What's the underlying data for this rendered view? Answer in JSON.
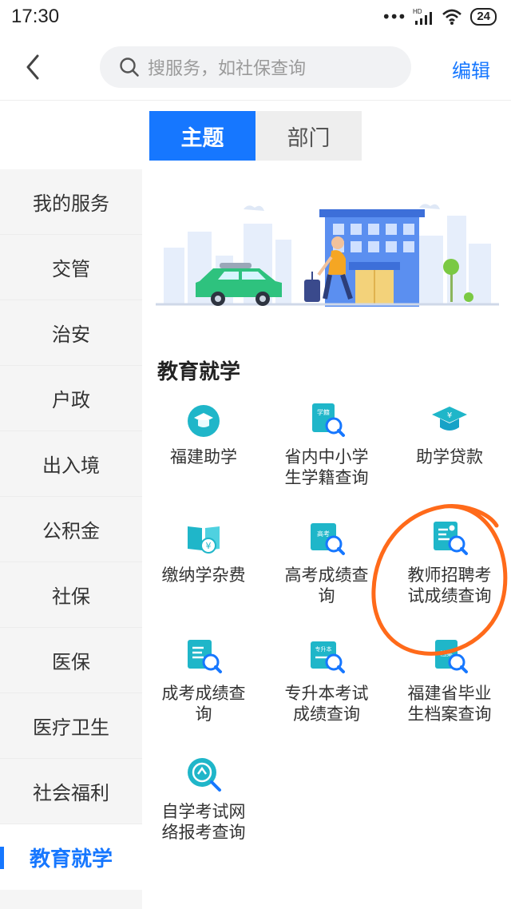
{
  "status": {
    "time": "17:30",
    "network": "HD",
    "battery": "24"
  },
  "nav": {
    "search_placeholder": "搜服务，如社保查询",
    "edit": "编辑"
  },
  "tabs": [
    {
      "label": "主题",
      "active": true
    },
    {
      "label": "部门",
      "active": false
    }
  ],
  "sidebar": {
    "items": [
      {
        "label": "我的服务"
      },
      {
        "label": "交管"
      },
      {
        "label": "治安"
      },
      {
        "label": "户政"
      },
      {
        "label": "出入境"
      },
      {
        "label": "公积金"
      },
      {
        "label": "社保"
      },
      {
        "label": "医保"
      },
      {
        "label": "医疗卫生"
      },
      {
        "label": "社会福利"
      },
      {
        "label": "教育就学",
        "active": true
      }
    ]
  },
  "section": {
    "title": "教育就学"
  },
  "services": [
    {
      "label": "福建助学",
      "icon": "graduate-cap-coin-icon"
    },
    {
      "label": "省内中小学生学籍查询",
      "icon": "student-record-search-icon",
      "badge": "学籍"
    },
    {
      "label": "助学贷款",
      "icon": "mortarboard-yen-icon"
    },
    {
      "label": "缴纳学杂费",
      "icon": "book-yen-icon"
    },
    {
      "label": "高考成绩查询",
      "icon": "gaokao-score-search-icon",
      "badge": "高考"
    },
    {
      "label": "教师招聘考试成绩查询",
      "icon": "teacher-score-search-icon"
    },
    {
      "label": "成考成绩查询",
      "icon": "adult-exam-score-icon"
    },
    {
      "label": "专升本考试成绩查询",
      "icon": "upgrade-exam-score-icon",
      "badge": "专升本"
    },
    {
      "label": "福建省毕业生档案查询",
      "icon": "graduate-archive-search-icon",
      "badge": "档案"
    },
    {
      "label": "自学考试网络报考查询",
      "icon": "self-study-exam-icon"
    }
  ],
  "colors": {
    "accent": "#1677ff",
    "teal": "#1fb6c9",
    "annotation": "#ff6a1a"
  }
}
